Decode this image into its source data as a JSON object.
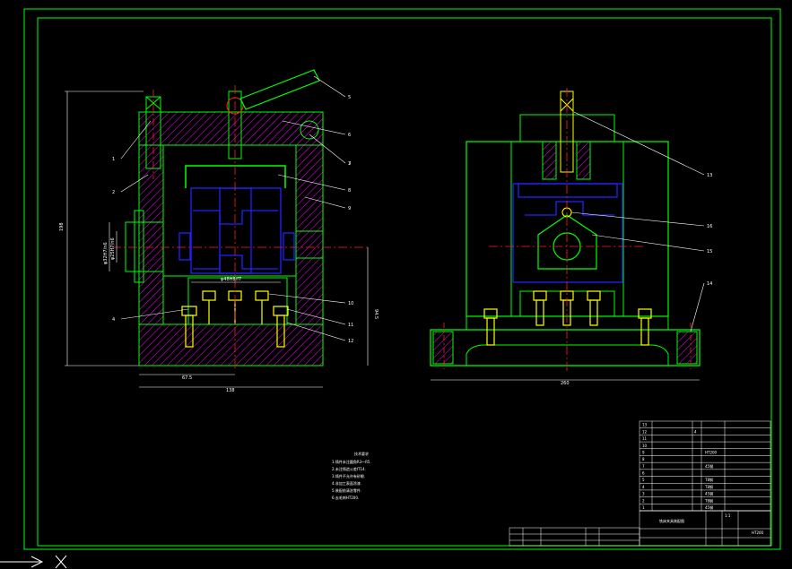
{
  "drawing": {
    "title": "",
    "colors": {
      "frame": "#00ff00",
      "outline": "#00ff00",
      "hidden": "#2222ff",
      "center": "#ff2020",
      "hatch": "#ff00ff",
      "bolt": "#ffff00",
      "leader": "#ffffff",
      "background": "#000000"
    }
  },
  "front_view": {
    "dimensions": {
      "overall_height": "198",
      "bottom_width": "138",
      "inner_width": "67.5",
      "right_height": "94.5",
      "left_a": "φ32H7/n6",
      "left_b": "φ25H7/n6",
      "top_fit": "φ48H8/f7"
    },
    "balloons": [
      "1",
      "2",
      "3",
      "4",
      "5",
      "6",
      "7",
      "8",
      "9",
      "10",
      "11",
      "12"
    ]
  },
  "side_view": {
    "dimensions": {
      "bottom_width": "260"
    },
    "balloons": [
      "13",
      "14",
      "15",
      "16"
    ]
  },
  "notes": {
    "heading": "技术要求",
    "lines": [
      "1.铸件未注圆角R3～R5.",
      "2.未注铸造公差IT14.",
      "3.铸件不允许有砂眼.",
      "4.非加工表面涂漆.",
      "5.装配前清洗零件.",
      "6.去毛刺HT200."
    ]
  },
  "parts_list": {
    "rows": [
      {
        "no": "13",
        "name": "",
        "qty": "",
        "mat": ""
      },
      {
        "no": "12",
        "name": "",
        "qty": "4",
        "mat": ""
      },
      {
        "no": "11",
        "name": "",
        "qty": "",
        "mat": ""
      },
      {
        "no": "10",
        "name": "",
        "qty": "",
        "mat": ""
      },
      {
        "no": "9",
        "name": "",
        "qty": "",
        "mat": "HT200"
      },
      {
        "no": "8",
        "name": "",
        "qty": "",
        "mat": ""
      },
      {
        "no": "7",
        "name": "",
        "qty": "",
        "mat": "45钢"
      },
      {
        "no": "6",
        "name": "",
        "qty": "",
        "mat": ""
      },
      {
        "no": "5",
        "name": "",
        "qty": "",
        "mat": "T8钢"
      },
      {
        "no": "4",
        "name": "",
        "qty": "",
        "mat": "T8钢"
      },
      {
        "no": "3",
        "name": "",
        "qty": "",
        "mat": "45钢"
      },
      {
        "no": "2",
        "name": "",
        "qty": "",
        "mat": "T8钢"
      },
      {
        "no": "1",
        "name": "",
        "qty": "",
        "mat": "45钢"
      }
    ],
    "title_text": "铣床夹具装配图",
    "scale": "1:1",
    "material": "HT200"
  }
}
